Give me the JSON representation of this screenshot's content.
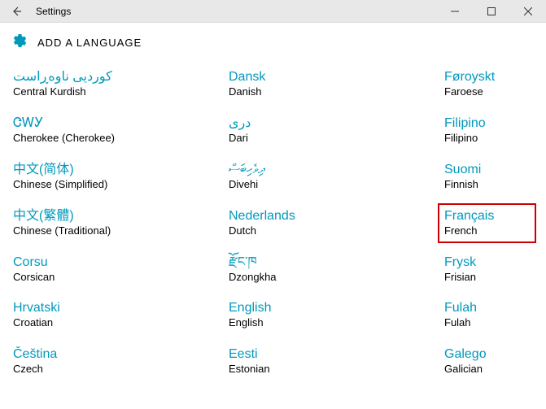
{
  "window": {
    "title": "Settings"
  },
  "header": {
    "page_title": "ADD A LANGUAGE"
  },
  "columns": [
    [
      {
        "native": "کوردیی ناوەڕاست",
        "english": "Central Kurdish"
      },
      {
        "native": "ᏣᎳᎩ",
        "english": "Cherokee (Cherokee)"
      },
      {
        "native": "中文(简体)",
        "english": "Chinese (Simplified)"
      },
      {
        "native": "中文(繁體)",
        "english": "Chinese (Traditional)"
      },
      {
        "native": "Corsu",
        "english": "Corsican"
      },
      {
        "native": "Hrvatski",
        "english": "Croatian"
      },
      {
        "native": "Čeština",
        "english": "Czech"
      }
    ],
    [
      {
        "native": "Dansk",
        "english": "Danish"
      },
      {
        "native": "درى",
        "english": "Dari"
      },
      {
        "native": "ދިވެހިބަސް",
        "english": "Divehi"
      },
      {
        "native": "Nederlands",
        "english": "Dutch"
      },
      {
        "native": "རྫོང་ཁ",
        "english": "Dzongkha"
      },
      {
        "native": "English",
        "english": "English"
      },
      {
        "native": "Eesti",
        "english": "Estonian"
      }
    ],
    [
      {
        "native": "Føroyskt",
        "english": "Faroese"
      },
      {
        "native": "Filipino",
        "english": "Filipino"
      },
      {
        "native": "Suomi",
        "english": "Finnish"
      },
      {
        "native": "Français",
        "english": "French",
        "highlighted": true
      },
      {
        "native": "Frysk",
        "english": "Frisian"
      },
      {
        "native": "Fulah",
        "english": "Fulah"
      },
      {
        "native": "Galego",
        "english": "Galician"
      }
    ]
  ]
}
